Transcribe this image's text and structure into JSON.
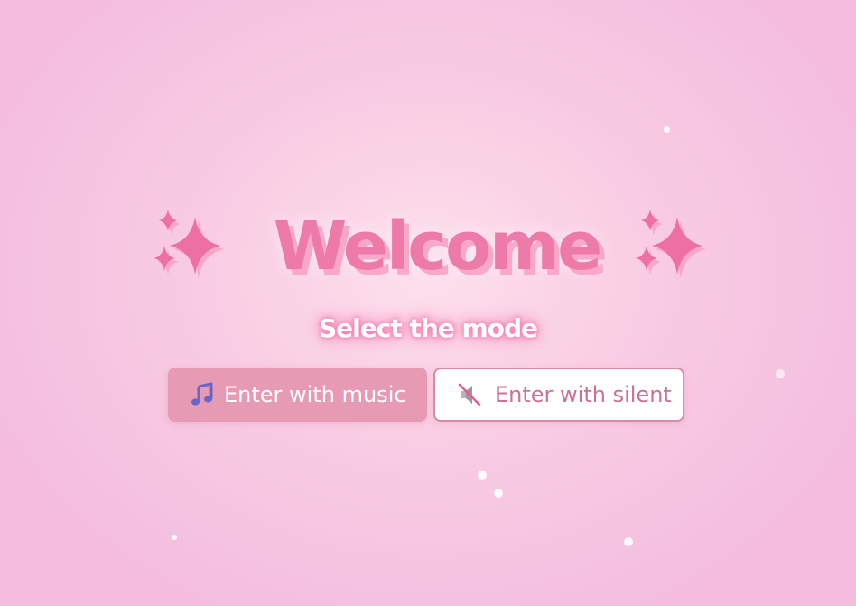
{
  "title": "Welcome",
  "subtitle": "Select the mode",
  "decorations": {
    "left_icon": "sparkles-icon",
    "right_icon": "sparkles-icon"
  },
  "buttons": {
    "music": {
      "label": "Enter with music",
      "icon": "music-note-icon"
    },
    "silent": {
      "label": "Enter with silent",
      "icon": "muted-speaker-icon"
    }
  },
  "colors": {
    "title": "#ee7aa9",
    "title_shadow": "#f8a9c9",
    "subtitle_glow": "#f77fb2",
    "music_button_bg": "#e69ab3",
    "silent_button_border": "#d98aa5",
    "silent_button_text": "#cf7095",
    "background": "#f9cde3"
  }
}
